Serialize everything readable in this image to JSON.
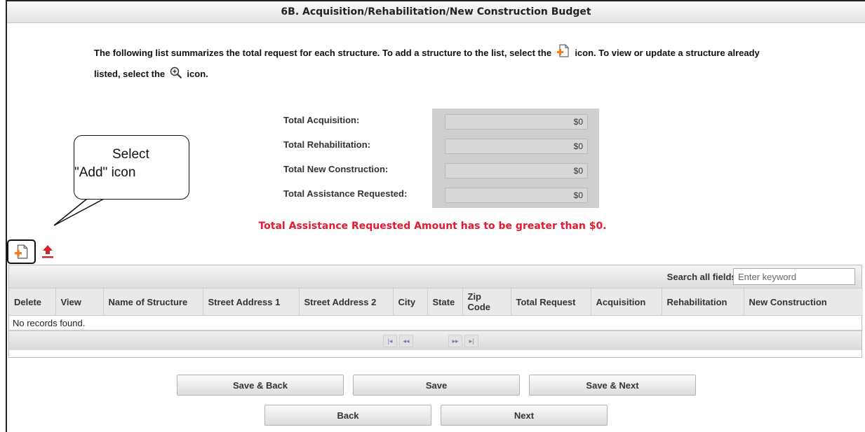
{
  "header": {
    "title": "6B. Acquisition/Rehabilitation/New Construction Budget"
  },
  "instructions": {
    "part1": "The following list summarizes the total request for each structure. To add a structure to the list, select the",
    "part2": "icon. To view or update a structure already listed, select the",
    "part3": "icon."
  },
  "totals": [
    {
      "label": "Total Acquisition:",
      "value": "$0"
    },
    {
      "label": "Total Rehabilitation:",
      "value": "$0"
    },
    {
      "label": "Total New Construction:",
      "value": "$0"
    },
    {
      "label": "Total Assistance Requested:",
      "value": "$0"
    }
  ],
  "error_message": "Total Assistance Requested Amount has to be greater than $0.",
  "callout": {
    "line1": "Select",
    "line2": "\"Add\" icon"
  },
  "table": {
    "search_label": "Search all fields:",
    "search_placeholder": "Enter keyword",
    "columns": [
      "Delete",
      "View",
      "Name of Structure",
      "Street Address 1",
      "Street Address 2",
      "City",
      "State",
      "Zip Code",
      "Total Request",
      "Acquisition",
      "Rehabilitation",
      "New Construction"
    ],
    "empty_text": "No records found.",
    "pager": [
      "|◂",
      "◂◂",
      "▸▸",
      "▸|"
    ]
  },
  "buttons": {
    "save_back": "Save & Back",
    "save": "Save",
    "save_next": "Save & Next",
    "back": "Back",
    "next": "Next"
  },
  "colors": {
    "error": "#e8182f",
    "add_icon_accent": "#f07c1e",
    "upload_icon": "#d22330"
  },
  "icons": {
    "add": "add-document-icon",
    "view": "magnifier-plus-icon",
    "upload": "upload-arrow-icon"
  }
}
